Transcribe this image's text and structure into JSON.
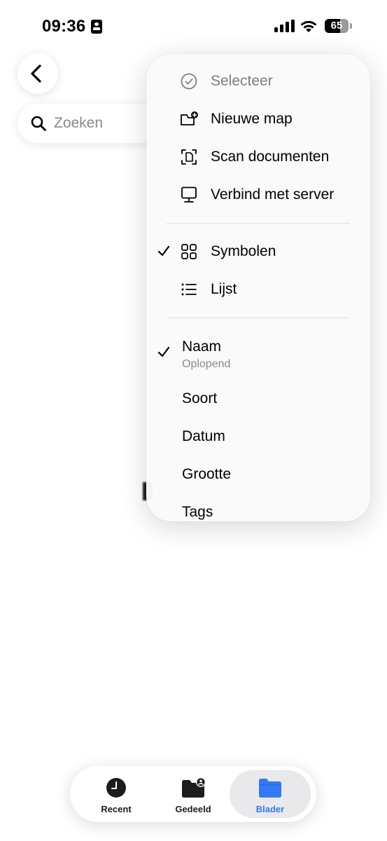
{
  "status_bar": {
    "time": "09:36",
    "battery_percent": "65",
    "battery_level": 0.65
  },
  "search": {
    "placeholder": "Zoeken"
  },
  "menu": {
    "actions": [
      {
        "label": "Selecteer",
        "icon": "checkmark-circle-icon",
        "disabled": true
      },
      {
        "label": "Nieuwe map",
        "icon": "folder-plus-icon"
      },
      {
        "label": "Scan documenten",
        "icon": "scan-document-icon"
      },
      {
        "label": "Verbind met server",
        "icon": "server-display-icon"
      }
    ],
    "view_options": [
      {
        "label": "Symbolen",
        "icon": "grid-icon",
        "checked": true
      },
      {
        "label": "Lijst",
        "icon": "list-icon",
        "checked": false
      }
    ],
    "sort_options": [
      {
        "label": "Naam",
        "sublabel": "Oplopend",
        "checked": true
      },
      {
        "label": "Soort",
        "checked": false
      },
      {
        "label": "Datum",
        "checked": false
      },
      {
        "label": "Grootte",
        "checked": false
      },
      {
        "label": "Tags",
        "checked": false
      }
    ]
  },
  "tab_bar": {
    "tabs": [
      {
        "label": "Recent",
        "icon": "clock-icon",
        "active": false
      },
      {
        "label": "Gedeeld",
        "icon": "shared-folder-icon",
        "active": false
      },
      {
        "label": "Blader",
        "icon": "folder-icon",
        "active": true
      }
    ],
    "accent_color": "#3478f6"
  }
}
